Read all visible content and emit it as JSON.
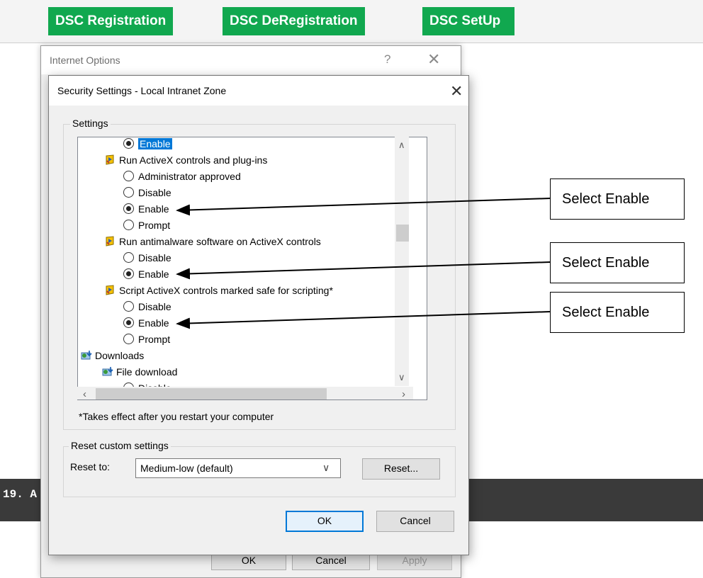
{
  "site": {
    "buttons": [
      "DSC Registration",
      "DSC DeRegistration",
      "DSC SetUp"
    ],
    "footer_text": "19. A",
    "brand_color": "#11a84f"
  },
  "internet_options": {
    "title": "Internet Options",
    "help_glyph": "?",
    "close_glyph": "✕",
    "buttons": {
      "ok": "OK",
      "cancel": "Cancel",
      "apply": "Apply"
    }
  },
  "security_settings": {
    "title": "Security Settings - Local Intranet Zone",
    "close_glyph": "✕",
    "settings_group_label": "Settings",
    "items": [
      {
        "kind": "radio",
        "label": "Enable",
        "checked": true,
        "highlighted": true
      },
      {
        "kind": "header",
        "icon": "activex-shield-icon",
        "label": "Run ActiveX controls and plug-ins"
      },
      {
        "kind": "radio",
        "label": "Administrator approved",
        "checked": false
      },
      {
        "kind": "radio",
        "label": "Disable",
        "checked": false
      },
      {
        "kind": "radio",
        "label": "Enable",
        "checked": true
      },
      {
        "kind": "radio",
        "label": "Prompt",
        "checked": false
      },
      {
        "kind": "header",
        "icon": "activex-shield-icon",
        "label": "Run antimalware software on ActiveX controls"
      },
      {
        "kind": "radio",
        "label": "Disable",
        "checked": false
      },
      {
        "kind": "radio",
        "label": "Enable",
        "checked": true
      },
      {
        "kind": "header",
        "icon": "activex-shield-icon",
        "label": "Script ActiveX controls marked safe for scripting*"
      },
      {
        "kind": "radio",
        "label": "Disable",
        "checked": false
      },
      {
        "kind": "radio",
        "label": "Enable",
        "checked": true
      },
      {
        "kind": "radio",
        "label": "Prompt",
        "checked": false
      },
      {
        "kind": "section",
        "icon": "downloads-icon",
        "label": "Downloads"
      },
      {
        "kind": "header2",
        "icon": "downloads-icon",
        "label": "File download"
      },
      {
        "kind": "radio",
        "label": "Disable",
        "checked": false
      }
    ],
    "footnote": "*Takes effect after you restart your computer",
    "reset_group_label": "Reset custom settings",
    "reset_to_label": "Reset to:",
    "reset_select_value": "Medium-low (default)",
    "reset_button": "Reset...",
    "ok_button": "OK",
    "cancel_button": "Cancel",
    "accent_color": "#0078d7"
  },
  "annotations": {
    "callouts": [
      "Select Enable",
      "Select Enable",
      "Select Enable"
    ]
  }
}
